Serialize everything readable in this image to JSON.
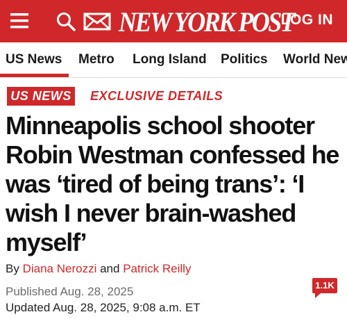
{
  "header": {
    "logo": "NEW YORK POST",
    "login_label": "LOG IN",
    "icons": [
      "menu-icon",
      "search-icon",
      "mail-icon"
    ],
    "brand_color": "#d0282a"
  },
  "nav": {
    "items": [
      {
        "label": "US News",
        "active": true
      },
      {
        "label": "Metro"
      },
      {
        "label": "Long Island"
      },
      {
        "label": "Politics"
      },
      {
        "label": "World New"
      }
    ]
  },
  "article": {
    "section": "US NEWS",
    "kicker": "EXCLUSIVE DETAILS",
    "headline": "Minneapolis school shooter Robin Westman confessed he was ‘tired of being trans’: ‘I wish I never brain-washed myself’",
    "byline": {
      "prefix": "By",
      "author1": "Diana Nerozzi",
      "conjunction": "and",
      "author2": "Patrick Reilly"
    },
    "published": "Published Aug. 28, 2025",
    "updated": "Updated Aug. 28, 2025, 9:08 a.m. ET",
    "comments_count": "1.1K"
  }
}
